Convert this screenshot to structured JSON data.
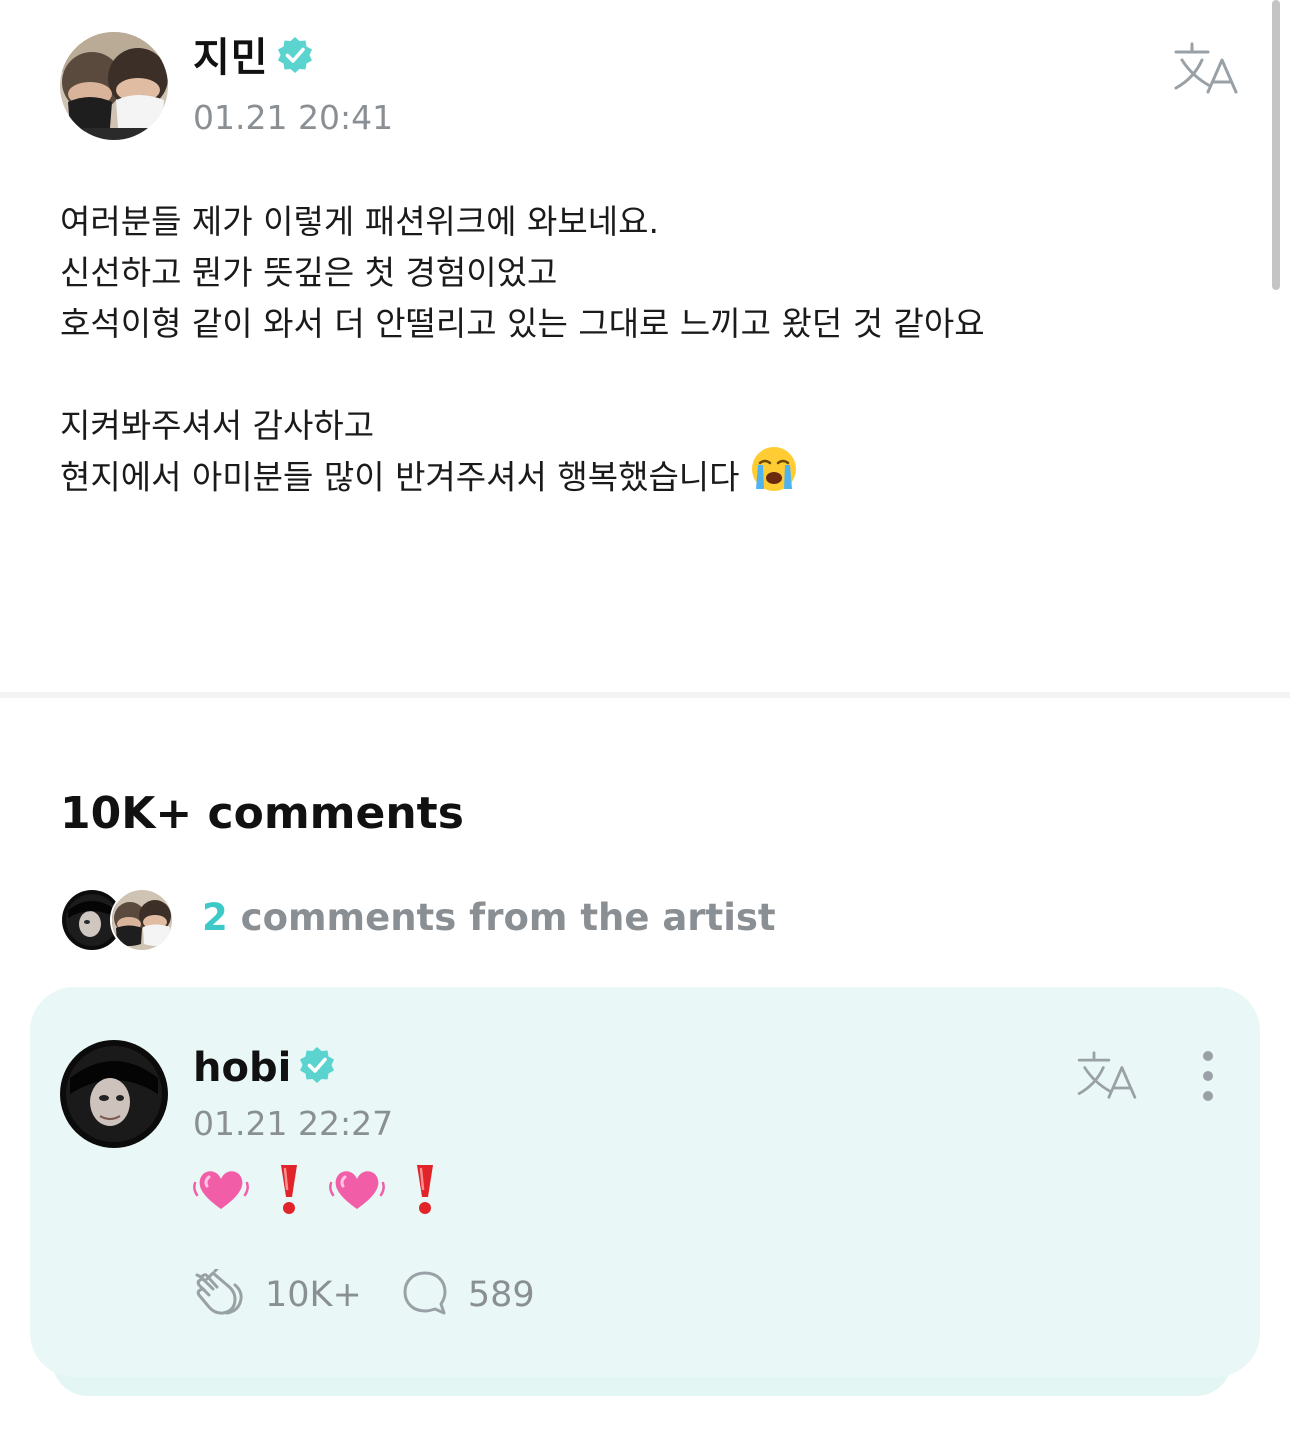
{
  "post": {
    "author": "지민",
    "timestamp": "01.21 20:41",
    "lines": [
      "여러분들 제가 이렇게 패션위크에 와보네요.",
      "신선하고 뭔가 뜻깊은 첫 경험이었고",
      "호석이형 같이 와서 더 안떨리고 있는 그대로 느끼고 왔던 것 같아요",
      "지켜봐주셔서 감사하고",
      "현지에서 아미분들 많이 반겨주셔서 행복했습니다"
    ],
    "emoji": "crying-face-emoji"
  },
  "comments": {
    "heading": "10K+ comments",
    "artist_count": "2",
    "artist_text": "comments from the artist"
  },
  "comment": {
    "author": "hobi",
    "timestamp": "01.21 22:27",
    "emojis": [
      "growing-heart",
      "red-exclamation",
      "growing-heart",
      "red-exclamation"
    ],
    "likes": "10K+",
    "replies": "589"
  },
  "icons": {
    "translate": "translate-icon",
    "verified": "verified-badge-icon",
    "more": "more-vertical-icon",
    "like": "hands-clap-icon",
    "reply": "speech-bubble-icon"
  },
  "colors": {
    "accent": "#3ec9c9",
    "muted_text": "#8a8f94",
    "card_bg": "#e9f8f6"
  }
}
